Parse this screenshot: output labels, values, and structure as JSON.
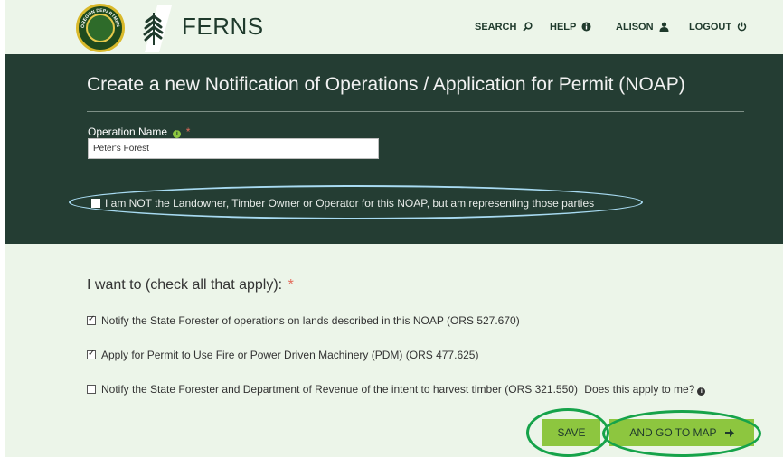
{
  "header": {
    "brand": "FERNS",
    "nav": {
      "search": "SEARCH",
      "help": "HELP",
      "user": "ALISON",
      "logout": "LOGOUT"
    },
    "logo_text": "OREGON DEPARTMENT OF FORESTRY"
  },
  "form": {
    "title": "Create a new Notification of Operations / Application for Permit (NOAP)",
    "operation_name_label": "Operation Name",
    "required_mark": "*",
    "operation_name_value": "Peter's Forest",
    "representing_label": "I am NOT the Landowner, Timber Owner or Operator for this NOAP, but am representing those parties"
  },
  "intent": {
    "heading": "I want to (check all that apply):",
    "required_mark": "*",
    "options": [
      {
        "label": "Notify the State Forester of operations on lands described in this NOAP (ORS 527.670)",
        "checked": true
      },
      {
        "label": "Apply for Permit to Use Fire or Power Driven Machinery (PDM) (ORS 477.625)",
        "checked": true
      },
      {
        "label": "Notify the State Forester and Department of Revenue of the intent to harvest timber (ORS 321.550)",
        "checked": false
      }
    ],
    "help_link": "Does this apply to me?"
  },
  "actions": {
    "save": "SAVE",
    "save_and_map": "AND GO TO MAP"
  },
  "colors": {
    "header_bg": "#ecf5e9",
    "panel_bg": "#243d33",
    "button_green": "#8dc63f",
    "highlight_blue": "#a8dbf2",
    "highlight_green": "#16a34a"
  }
}
